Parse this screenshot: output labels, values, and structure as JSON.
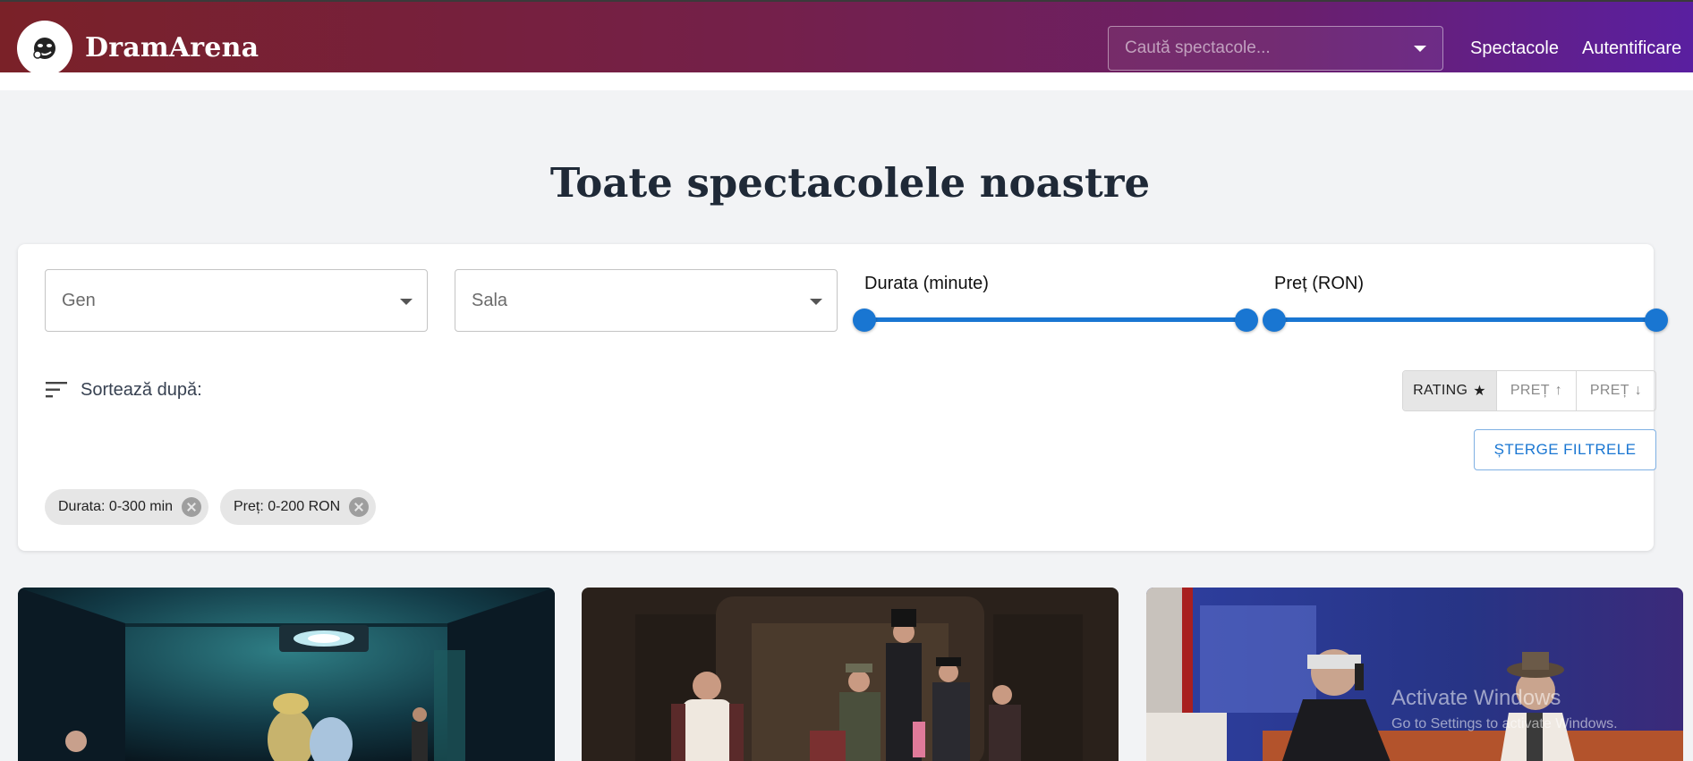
{
  "header": {
    "brand": "DramArena",
    "search_placeholder": "Caută spectacole...",
    "nav": [
      "Spectacole",
      "Autentificare"
    ]
  },
  "page": {
    "title": "Toate spectacolele noastre"
  },
  "filters": {
    "genre_label": "Gen",
    "hall_label": "Sala",
    "duration_label": "Durata (minute)",
    "duration_range": [
      0,
      300
    ],
    "price_label": "Preț (RON)",
    "price_range": [
      0,
      200
    ],
    "sort_label": "Sortează după:",
    "sort_options": [
      {
        "label": "RATING",
        "icon": "★",
        "active": true
      },
      {
        "label": "PREȚ",
        "icon": "↑",
        "active": false
      },
      {
        "label": "PREȚ",
        "icon": "↓",
        "active": false
      }
    ],
    "clear_label": "ȘTERGE FILTRELE",
    "chips": [
      "Durata: 0-300 min",
      "Preț: 0-200 RON"
    ]
  },
  "shows": [
    {
      "image": "stage-scene-teal"
    },
    {
      "image": "stage-scene-period-costumes"
    },
    {
      "image": "stage-scene-telephone"
    }
  ],
  "watermark": {
    "line1": "Activate Windows",
    "line2": "Go to Settings to activate Windows."
  },
  "colors": {
    "accent": "#1976d2",
    "header_start": "#7a2128",
    "header_end": "#5a1fa0"
  }
}
